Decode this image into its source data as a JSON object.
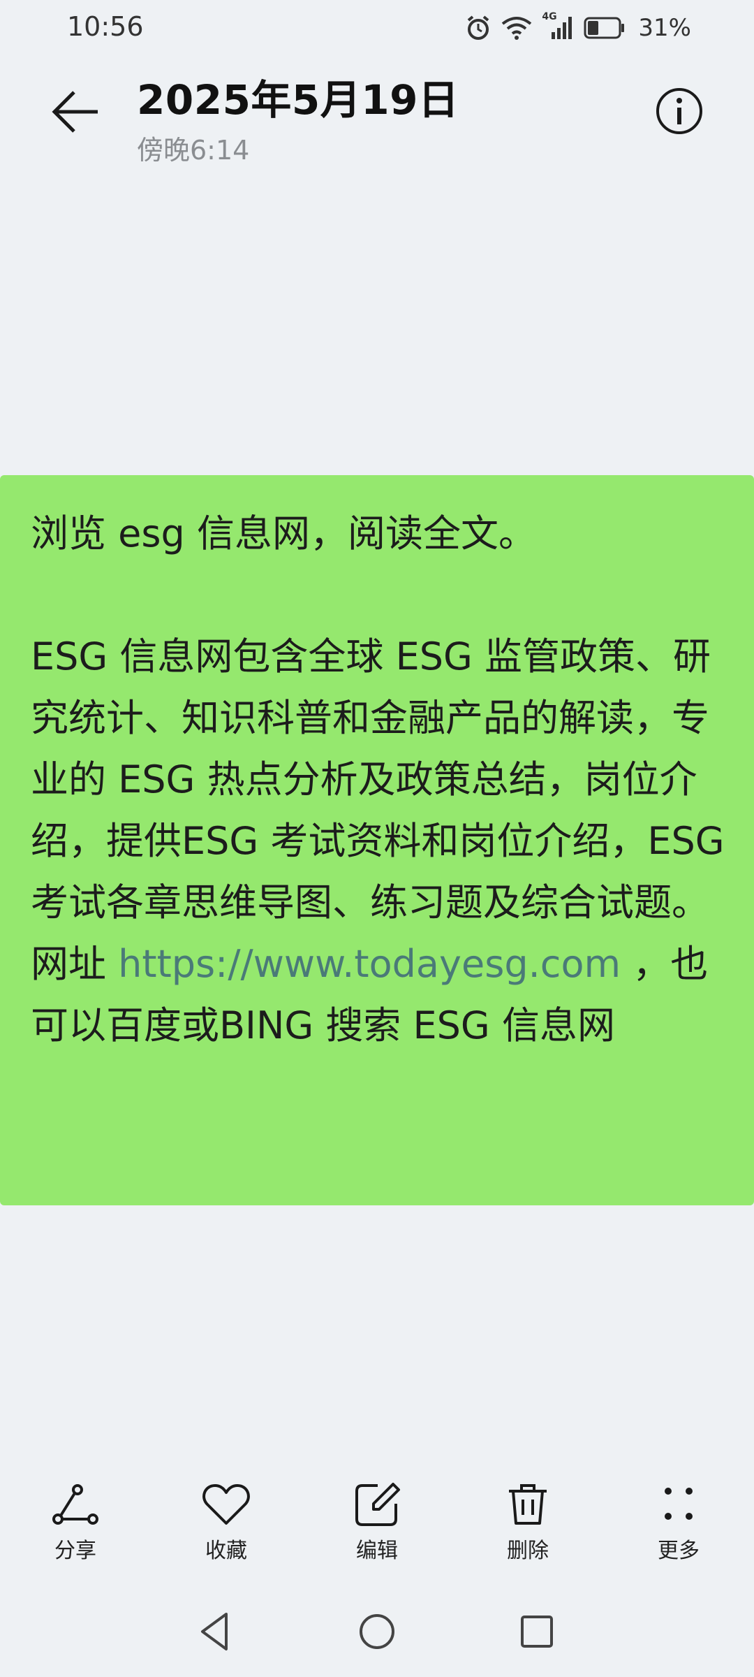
{
  "status_bar": {
    "time": "10:56",
    "network": "4G",
    "battery": "31%"
  },
  "header": {
    "title": "2025年5月19日",
    "subtitle": "傍晚6:14"
  },
  "message": {
    "line_1": "浏览 esg 信息网，阅读全文。",
    "body_before_link": "ESG 信息网包含全球 ESG 监管政策、研究统计、知识科普和金融产品的解读，专业的 ESG 热点分析及政策总结，岗位介绍，提供ESG 考试资料和岗位介绍，ESG 考试各章思维导图、练习题及综合试题。网址 ",
    "link": "https://www.todayesg.com",
    "body_after_link": " ，也可以百度或BING 搜索 ESG 信息网",
    "bubble_color": "#95e86e",
    "link_color": "#4a7a78"
  },
  "toolbar": {
    "share": "分享",
    "favorite": "收藏",
    "edit": "编辑",
    "delete": "删除",
    "more": "更多"
  },
  "icons": {
    "back": "arrow-left-icon",
    "info": "info-icon",
    "share": "share-icon",
    "favorite": "heart-icon",
    "edit": "edit-icon",
    "delete": "trash-icon",
    "more": "more-dots-icon"
  }
}
